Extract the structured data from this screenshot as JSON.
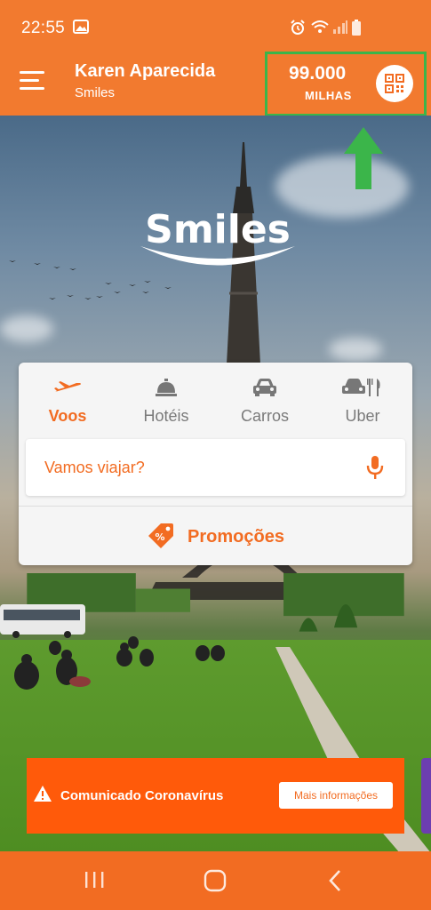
{
  "status_bar": {
    "time": "22:55",
    "icons": [
      "image-icon",
      "alarm-icon",
      "wifi-icon",
      "signal-icon",
      "battery-icon"
    ]
  },
  "header": {
    "user_name": "Karen Aparecida",
    "user_subtitle": "Smiles",
    "miles_value": "99.000",
    "miles_label": "MILHAS",
    "qr_icon": "qr-code-icon"
  },
  "hero": {
    "logo_text": "Smiles"
  },
  "booking_card": {
    "tabs": [
      {
        "label": "Voos",
        "icon": "plane-icon",
        "active": true
      },
      {
        "label": "Hotéis",
        "icon": "hotel-bell-icon",
        "active": false
      },
      {
        "label": "Carros",
        "icon": "car-icon",
        "active": false
      },
      {
        "label": "Uber",
        "icon": "car-dining-icon",
        "active": false
      }
    ],
    "search_placeholder": "Vamos viajar?",
    "promo_label": "Promoções"
  },
  "banner": {
    "text": "Comunicado Coronavírus",
    "button_label": "Mais informações"
  },
  "colors": {
    "brand_orange": "#f26c22",
    "banner_orange": "#ff5a0a",
    "highlight_green": "#3bb54a"
  }
}
